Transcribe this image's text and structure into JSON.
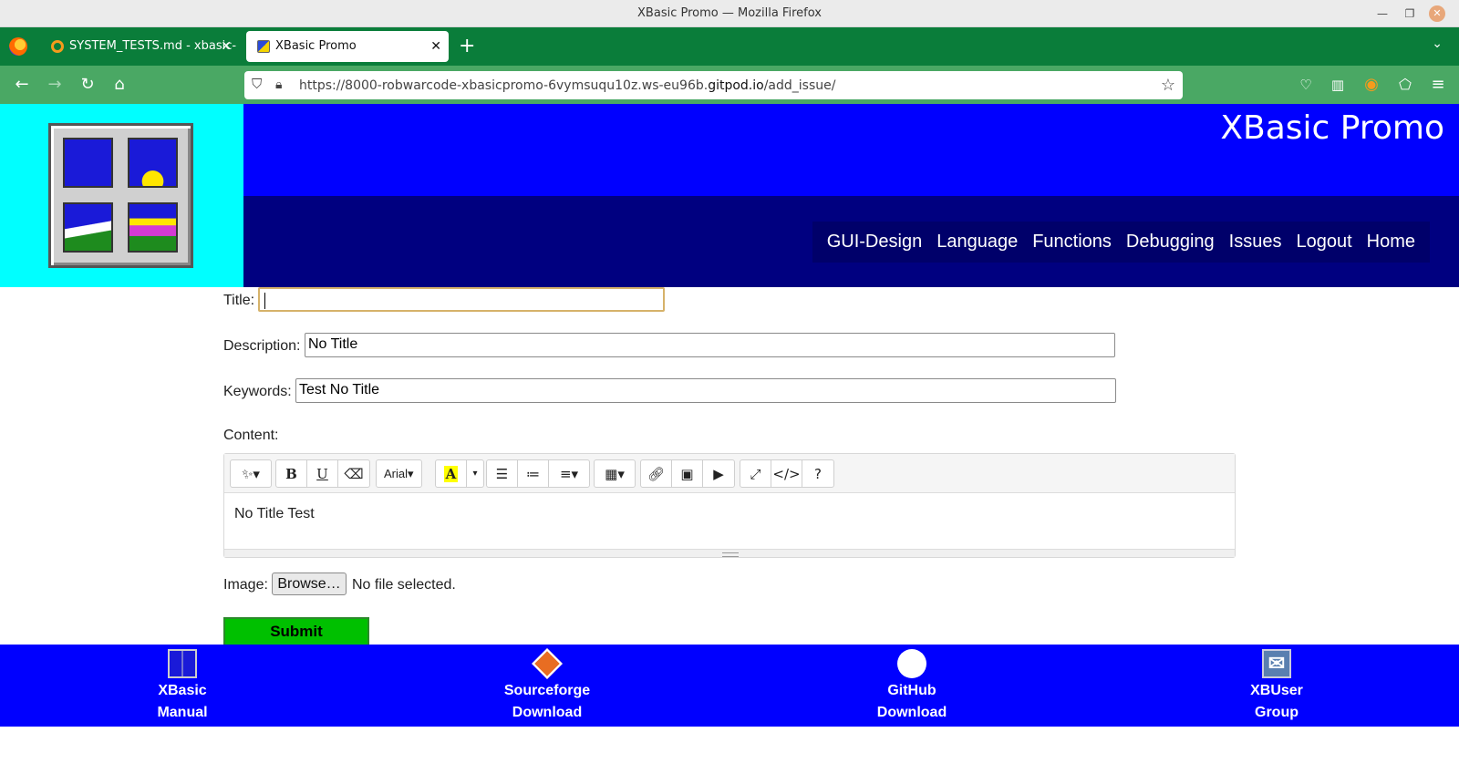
{
  "window": {
    "title": "XBasic Promo — Mozilla Firefox"
  },
  "tabs": [
    {
      "label": "SYSTEM_TESTS.md - xbasic-"
    },
    {
      "label": "XBasic Promo"
    }
  ],
  "navbar": {
    "url_prefix": "https://8000-robwarcode-xbasicpromo-6vymsuqu10z.ws-eu96b.",
    "url_domain": "gitpod.io",
    "url_path": "/add_issue/"
  },
  "header": {
    "site_title": "XBasic Promo",
    "menu": [
      "GUI-Design",
      "Language",
      "Functions",
      "Debugging",
      "Issues",
      "Logout",
      "Home"
    ]
  },
  "form": {
    "title_label": "Title:",
    "title_value": "",
    "description_label": "Description:",
    "description_value": "No Title",
    "keywords_label": "Keywords:",
    "keywords_value": "Test No Title",
    "content_label": "Content:",
    "editor_font": "Arial",
    "editor_content": "No Title Test",
    "image_label": "Image:",
    "browse_label": "Browse…",
    "file_status": "No file selected.",
    "submit_label": "Submit"
  },
  "footer": {
    "items": [
      {
        "line1": "XBasic",
        "line2": "Manual",
        "icon": "xbasic-logo-icon"
      },
      {
        "line1": "Sourceforge",
        "line2": "Download",
        "icon": "sourceforge-icon"
      },
      {
        "line1": "GitHub",
        "line2": "Download",
        "icon": "github-icon"
      },
      {
        "line1": "XBUser",
        "line2": "Group",
        "icon": "mail-icon"
      }
    ]
  },
  "colors": {
    "banner_blue": "#0000ff",
    "banner_navy": "#000080",
    "logo_bg": "#00ffff",
    "browser_green": "#0a7d3a",
    "submit_green": "#00c000"
  }
}
